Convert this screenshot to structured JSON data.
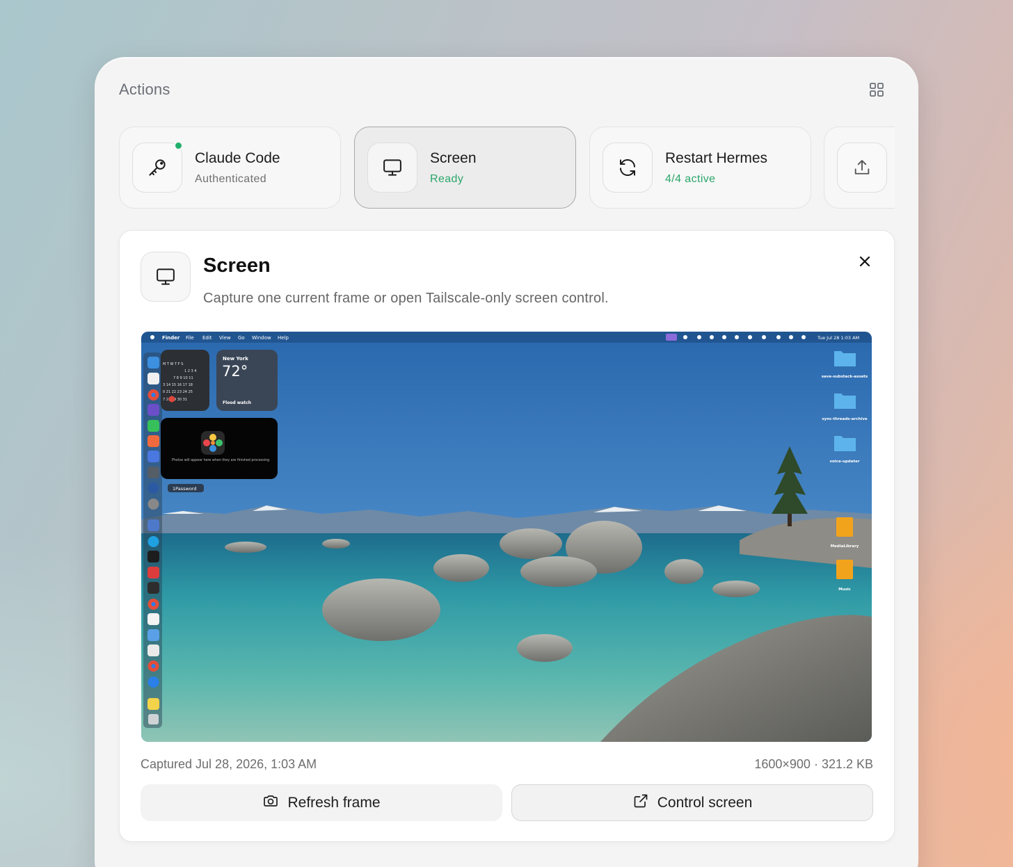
{
  "panel": {
    "title": "Actions"
  },
  "actions": [
    {
      "label": "Claude Code",
      "status": "Authenticated",
      "icon": "key-icon",
      "status_color": "#6f6f6f",
      "indicator": "online"
    },
    {
      "label": "Screen",
      "status": "Ready",
      "icon": "monitor-icon",
      "status_color": "#2aa66a",
      "selected": true
    },
    {
      "label": "Restart Hermes",
      "status": "4/4 active",
      "icon": "refresh-icon",
      "status_color": "#2aa66a"
    },
    {
      "label": "",
      "status": "",
      "icon": "upload-icon"
    }
  ],
  "detail": {
    "title": "Screen",
    "description": "Capture one current frame or open Tailscale-only screen control.",
    "captured": "Captured Jul 28, 2026, 1:03 AM",
    "frame_info": "1600×900 · 321.2 KB",
    "refresh_label": "Refresh frame",
    "control_label": "Control screen"
  },
  "screenshot": {
    "menu_items": [
      "Finder",
      "File",
      "Edit",
      "View",
      "Go",
      "Window",
      "Help"
    ],
    "clock": "Tue Jul 28  1:03 AM",
    "weather_city": "New York",
    "weather_temp": "72°",
    "weather_note": "Flood watch",
    "photos_note": "Photos will appear here when they are finished processing",
    "tooltip": "1Password",
    "calendar_rows": [
      "M T W T F S",
      "1 2 3 4",
      "7 8 9 10 11",
      "3 14 15 16 17 18",
      "0 21 22 23 24 25",
      "7 28 29 30 31"
    ],
    "desktop_items": [
      "save-substack-assets",
      "sync-threads-archive",
      "voice-updater",
      "MediaLibrary",
      "Music"
    ]
  },
  "colors": {
    "accent_green": "#2aa66a",
    "status_dot": "#22b06a"
  }
}
